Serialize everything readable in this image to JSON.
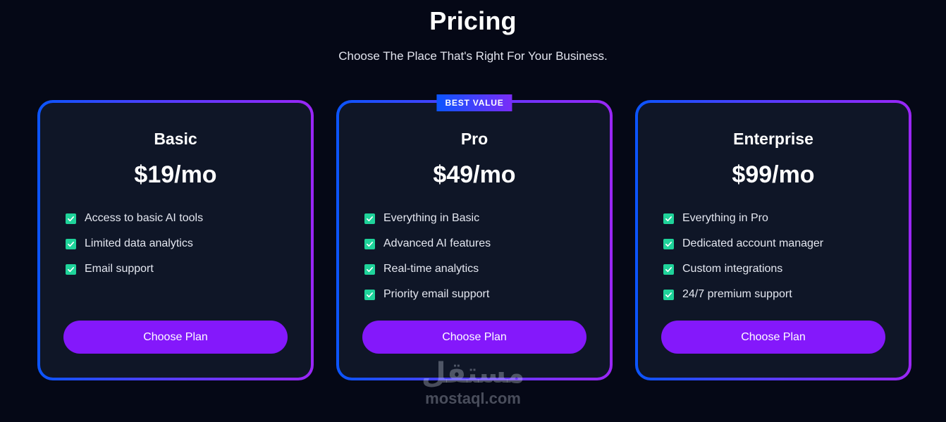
{
  "header": {
    "title": "Pricing",
    "subtitle": "Choose The Place That's Right For Your Business."
  },
  "plans": [
    {
      "name": "Basic",
      "price": "$19/mo",
      "badge": "",
      "features": [
        "Access to basic AI tools",
        "Limited data analytics",
        "Email support"
      ],
      "button_label": "Choose Plan"
    },
    {
      "name": "Pro",
      "price": "$49/mo",
      "badge": "BEST VALUE",
      "features": [
        "Everything in Basic",
        "Advanced AI features",
        "Real-time analytics",
        "Priority email support"
      ],
      "button_label": "Choose Plan"
    },
    {
      "name": "Enterprise",
      "price": "$99/mo",
      "badge": "",
      "features": [
        "Everything in Pro",
        "Dedicated account manager",
        "Custom integrations",
        "24/7 premium support"
      ],
      "button_label": "Choose Plan"
    }
  ],
  "watermark": {
    "logo_text": "مستقل",
    "url": "mostaql.com"
  },
  "colors": {
    "background": "#050816",
    "card_background": "#0f1627",
    "border_gradient_start": "#0b55ff",
    "border_gradient_end": "#9a26f6",
    "button": "#8418fb",
    "check": "#1fd39a"
  },
  "icons": {
    "feature_check": "check-square-icon"
  }
}
